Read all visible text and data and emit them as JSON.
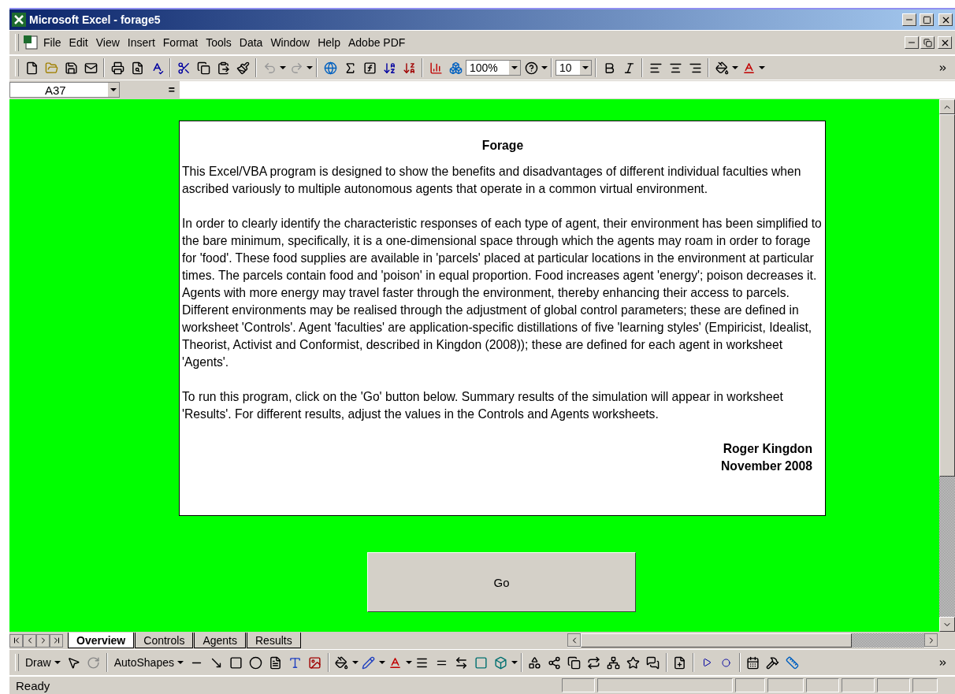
{
  "window": {
    "title": "Microsoft Excel - forage5"
  },
  "menu": [
    "File",
    "Edit",
    "View",
    "Insert",
    "Format",
    "Tools",
    "Data",
    "Window",
    "Help",
    "Adobe PDF"
  ],
  "toolbar": {
    "zoom": "100%",
    "font_size": "10"
  },
  "formula_bar": {
    "name_box": "A37",
    "equals": "="
  },
  "document": {
    "title": "Forage",
    "paragraphs": [
      "This Excel/VBA program is designed to show the benefits and disadvantages of different individual faculties when ascribed variously to multiple autonomous agents that operate in a common virtual environment.",
      "In order to clearly identify the characteristic responses of each type of agent, their environment has been simplified to the bare minimum, specifically, it is a one-dimensional space through which the agents may roam in order to forage for 'food'.  These food supplies are available in 'parcels' placed at particular locations in the environment at particular times.  The parcels contain food and 'poison' in equal proportion.  Food increases agent 'energy';  poison decreases it.  Agents with more energy may travel faster through the environment, thereby enhancing their access to parcels.  Different environments may be realised through the adjustment of global control parameters;  these are defined in worksheet 'Controls'.  Agent 'faculties' are application-specific distillations of five 'learning styles' (Empiricist, Idealist, Theorist, Activist and Conformist, described in Kingdon (2008));  these are defined for each agent in worksheet 'Agents'.",
      "To run this program, click on the 'Go' button below.  Summary results of the simulation will appear in worksheet 'Results'.  For different results, adjust the values in the Controls and Agents worksheets."
    ],
    "author": "Roger Kingdon",
    "date": "November 2008"
  },
  "go_button": "Go",
  "sheet_tabs": [
    {
      "label": "Overview",
      "selected": true
    },
    {
      "label": "Controls",
      "selected": false
    },
    {
      "label": "Agents",
      "selected": false
    },
    {
      "label": "Results",
      "selected": false
    }
  ],
  "drawing_toolbar": {
    "draw_menu": "Draw",
    "autoshapes_menu": "AutoShapes"
  },
  "status_bar": {
    "text": "Ready"
  }
}
